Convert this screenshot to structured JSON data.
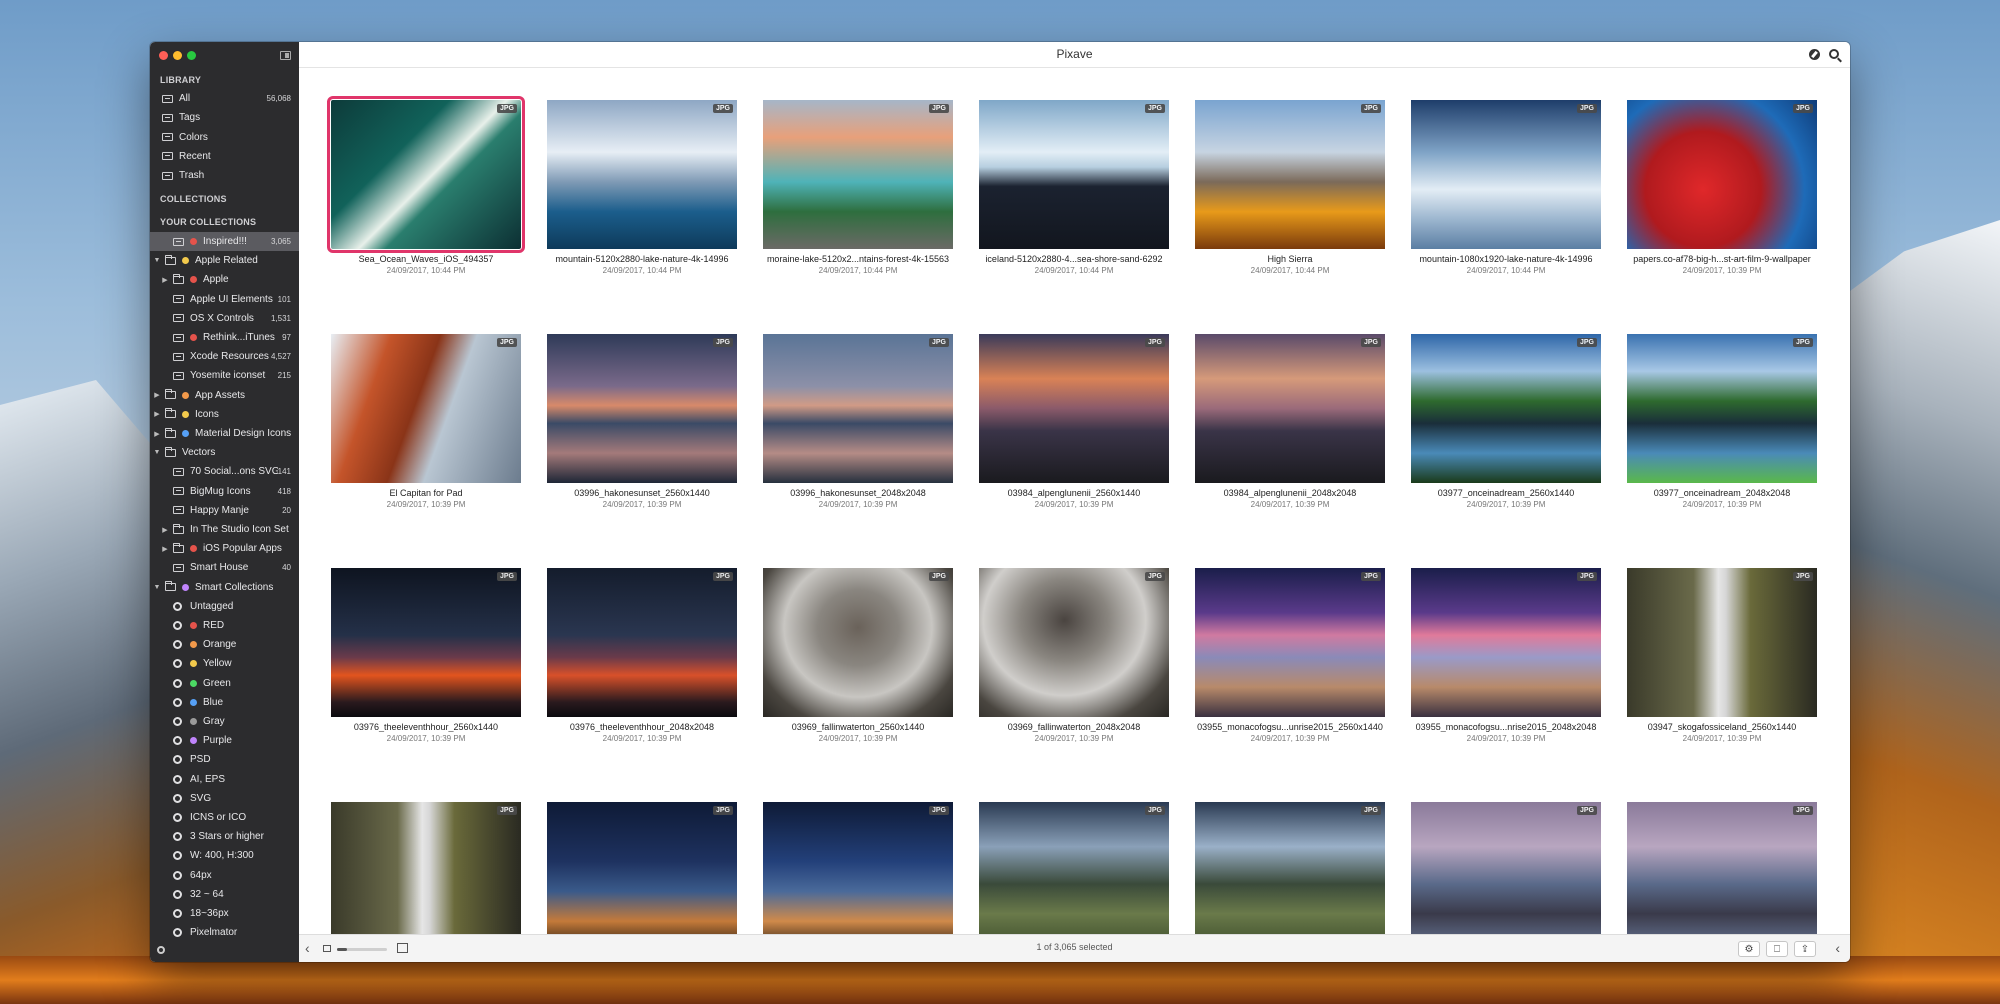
{
  "app": {
    "title": "Pixave"
  },
  "sidebar": {
    "library_header": "LIBRARY",
    "library": [
      {
        "label": "All",
        "count": "56,068",
        "icon": "stack-icon"
      },
      {
        "label": "Tags",
        "count": "",
        "icon": "tag-icon"
      },
      {
        "label": "Colors",
        "count": "",
        "icon": "drop-icon"
      },
      {
        "label": "Recent",
        "count": "",
        "icon": "clock-icon"
      },
      {
        "label": "Trash",
        "count": "",
        "icon": "trash-icon"
      }
    ],
    "collections_header": "COLLECTIONS",
    "your_collections_header": "YOUR COLLECTIONS",
    "tree": [
      {
        "label": "Inspired!!!",
        "count": "3,065",
        "depth": 1,
        "icon": "coll",
        "dot": "#e5534b",
        "tri": "",
        "selected": true
      },
      {
        "label": "Apple Related",
        "count": "",
        "depth": 0,
        "icon": "folder",
        "dot": "#f2c94c",
        "tri": "▼"
      },
      {
        "label": "Apple",
        "count": "",
        "depth": 1,
        "icon": "folder",
        "dot": "#e5534b",
        "tri": "▶"
      },
      {
        "label": "Apple UI Elements",
        "count": "101",
        "depth": 1,
        "icon": "coll",
        "dot": "",
        "tri": ""
      },
      {
        "label": "OS X Controls",
        "count": "1,531",
        "depth": 1,
        "icon": "coll",
        "dot": "",
        "tri": ""
      },
      {
        "label": "Rethink...iTunes",
        "count": "97",
        "depth": 1,
        "icon": "coll",
        "dot": "#e5534b",
        "tri": ""
      },
      {
        "label": "Xcode Resources",
        "count": "4,527",
        "depth": 1,
        "icon": "coll",
        "dot": "",
        "tri": ""
      },
      {
        "label": "Yosemite iconset",
        "count": "215",
        "depth": 1,
        "icon": "coll",
        "dot": "",
        "tri": ""
      },
      {
        "label": "App Assets",
        "count": "",
        "depth": 0,
        "icon": "folder",
        "dot": "#f2994a",
        "tri": "▶"
      },
      {
        "label": "Icons",
        "count": "",
        "depth": 0,
        "icon": "folder",
        "dot": "#f2c94c",
        "tri": "▶"
      },
      {
        "label": "Material Design Icons",
        "count": "",
        "depth": 0,
        "icon": "folder",
        "dot": "#56a0f5",
        "tri": "▶"
      },
      {
        "label": "Vectors",
        "count": "",
        "depth": 0,
        "icon": "folder",
        "dot": "",
        "tri": "▼"
      },
      {
        "label": "70 Social...ons SVG",
        "count": "141",
        "depth": 1,
        "icon": "coll",
        "dot": "",
        "tri": ""
      },
      {
        "label": "BigMug Icons",
        "count": "418",
        "depth": 1,
        "icon": "coll",
        "dot": "",
        "tri": ""
      },
      {
        "label": "Happy Manje",
        "count": "20",
        "depth": 1,
        "icon": "coll",
        "dot": "",
        "tri": ""
      },
      {
        "label": "In The Studio Icon Set",
        "count": "",
        "depth": 1,
        "icon": "folder",
        "dot": "",
        "tri": "▶"
      },
      {
        "label": "iOS Popular Apps",
        "count": "",
        "depth": 1,
        "icon": "folder",
        "dot": "#e5534b",
        "tri": "▶"
      },
      {
        "label": "Smart House",
        "count": "40",
        "depth": 1,
        "icon": "coll",
        "dot": "",
        "tri": ""
      },
      {
        "label": "Smart Collections",
        "count": "",
        "depth": 0,
        "icon": "folder",
        "dot": "#c084fc",
        "tri": "▼"
      },
      {
        "label": "Untagged",
        "count": "",
        "depth": 1,
        "icon": "gear",
        "dot": "",
        "tri": ""
      },
      {
        "label": "RED",
        "count": "",
        "depth": 1,
        "icon": "gear",
        "dot": "#e5534b",
        "tri": ""
      },
      {
        "label": "Orange",
        "count": "",
        "depth": 1,
        "icon": "gear",
        "dot": "#f2994a",
        "tri": ""
      },
      {
        "label": "Yellow",
        "count": "",
        "depth": 1,
        "icon": "gear",
        "dot": "#f2c94c",
        "tri": ""
      },
      {
        "label": "Green",
        "count": "",
        "depth": 1,
        "icon": "gear",
        "dot": "#4cd964",
        "tri": ""
      },
      {
        "label": "Blue",
        "count": "",
        "depth": 1,
        "icon": "gear",
        "dot": "#56a0f5",
        "tri": ""
      },
      {
        "label": "Gray",
        "count": "",
        "depth": 1,
        "icon": "gear",
        "dot": "#9b9b9b",
        "tri": ""
      },
      {
        "label": "Purple",
        "count": "",
        "depth": 1,
        "icon": "gear",
        "dot": "#c084fc",
        "tri": ""
      },
      {
        "label": "PSD",
        "count": "",
        "depth": 1,
        "icon": "gear",
        "dot": "",
        "tri": ""
      },
      {
        "label": "AI, EPS",
        "count": "",
        "depth": 1,
        "icon": "gear",
        "dot": "",
        "tri": ""
      },
      {
        "label": "SVG",
        "count": "",
        "depth": 1,
        "icon": "gear",
        "dot": "",
        "tri": ""
      },
      {
        "label": "ICNS or ICO",
        "count": "",
        "depth": 1,
        "icon": "gear",
        "dot": "",
        "tri": ""
      },
      {
        "label": "3 Stars or higher",
        "count": "",
        "depth": 1,
        "icon": "gear",
        "dot": "",
        "tri": ""
      },
      {
        "label": "W: 400, H:300",
        "count": "",
        "depth": 1,
        "icon": "gear",
        "dot": "",
        "tri": ""
      },
      {
        "label": "64px",
        "count": "",
        "depth": 1,
        "icon": "gear",
        "dot": "",
        "tri": ""
      },
      {
        "label": "32 ~ 64",
        "count": "",
        "depth": 1,
        "icon": "gear",
        "dot": "",
        "tri": ""
      },
      {
        "label": "18~36px",
        "count": "",
        "depth": 1,
        "icon": "gear",
        "dot": "",
        "tri": ""
      },
      {
        "label": "Pixelmator",
        "count": "",
        "depth": 1,
        "icon": "gear",
        "dot": "",
        "tri": ""
      }
    ]
  },
  "grid": {
    "badge": "JPG",
    "items": [
      {
        "name": "Sea_Ocean_Waves_iOS_494357",
        "date": "24/09/2017, 10:44 PM",
        "selected": true,
        "bg": "linear-gradient(135deg,#0d3b3a 0%,#11625a 35%,#e8f0ea 52%,#2a7e6e 60%,#0c2f33 100%)"
      },
      {
        "name": "mountain-5120x2880-lake-nature-4k-14996",
        "date": "24/09/2017, 10:44 PM",
        "bg": "linear-gradient(180deg,#8ea7c4 0%,#e7eef5 35%,#7f9ab5 55%,#1b5e8c 75%,#0e3a5a 100%)"
      },
      {
        "name": "moraine-lake-5120x2...ntains-forest-4k-15563",
        "date": "24/09/2017, 10:44 PM",
        "bg": "linear-gradient(180deg,#a6b6c8 0%,#e8a07a 25%,#4fb3b8 55%,#2e6e3e 75%,#6b6a66 100%)"
      },
      {
        "name": "iceland-5120x2880-4...sea-shore-sand-6292",
        "date": "24/09/2017, 10:44 PM",
        "bg": "linear-gradient(180deg,#7fa7c8 0%,#e3eef6 35%,#b7cfe0 45%,#1b2230 58%,#12161e 100%)"
      },
      {
        "name": "High Sierra",
        "date": "24/09/2017, 10:44 PM",
        "bg": "linear-gradient(180deg,#7aa4d0 0%,#c7d4e2 35%,#7b6a5a 55%,#e89a1a 75%,#7a3a0c 100%)"
      },
      {
        "name": "mountain-1080x1920-lake-nature-4k-14996",
        "date": "24/09/2017, 10:44 PM",
        "bg": "linear-gradient(180deg,#1e3d6a 0%,#7fa3c6 35%,#e3edf5 60%,#9cb6cf 80%,#5b7ea3 100%)"
      },
      {
        "name": "papers.co-af78-big-h...st-art-film-9-wallpaper",
        "date": "24/09/2017, 10:39 PM",
        "bg": "radial-gradient(circle at 40% 60%,#e0282a 0%,#b01a1e 40%,#1e6bb8 70%,#0e3b78 100%)"
      },
      {
        "name": "El Capitan for Pad",
        "date": "24/09/2017, 10:39 PM",
        "bg": "linear-gradient(110deg,#e8eef4 0%,#c4542a 25%,#8a3418 45%,#b9c6d2 60%,#6c7c8e 100%)"
      },
      {
        "name": "03996_hakonesunset_2560x1440",
        "date": "24/09/2017, 10:39 PM",
        "bg": "linear-gradient(180deg,#2e3a58 0%,#7a6a8a 35%,#d88a6a 48%,#3a4a66 60%,#a47a7a 80%,#1e2636 100%)"
      },
      {
        "name": "03996_hakonesunset_2048x2048",
        "date": "24/09/2017, 10:39 PM",
        "bg": "linear-gradient(180deg,#5a7496 0%,#8c90a8 35%,#d19b86 48%,#3a4a66 60%,#b58c86 80%,#26303e 100%)"
      },
      {
        "name": "03984_alpenglunenii_2560x1440",
        "date": "24/09/2017, 10:39 PM",
        "bg": "linear-gradient(180deg,#3a3a5a 0%,#d98256 30%,#8a5a6a 50%,#3a3448 65%,#1a1a1e 100%)"
      },
      {
        "name": "03984_alpenglunenii_2048x2048",
        "date": "24/09/2017, 10:39 PM",
        "bg": "linear-gradient(180deg,#5a4a6a 0%,#d69a7a 30%,#9a6a7a 50%,#3a3448 65%,#1a1a1e 100%)"
      },
      {
        "name": "03977_onceinadream_2560x1440",
        "date": "24/09/2017, 10:39 PM",
        "bg": "linear-gradient(180deg,#2e66a8 0%,#9cc0e0 25%,#2e6a2e 45%,#1a2e3a 60%,#4a8ab8 80%,#1a3a1a 100%)"
      },
      {
        "name": "03977_onceinadream_2048x2048",
        "date": "24/09/2017, 10:39 PM",
        "bg": "linear-gradient(180deg,#3a72b0 0%,#a8c8e6 25%,#2e6a2e 45%,#1a2e3a 60%,#4a8ab8 80%,#5ab84a 100%)"
      },
      {
        "name": "03976_theeleventhhour_2560x1440",
        "date": "24/09/2017, 10:39 PM",
        "bg": "linear-gradient(180deg,#0e1420 0%,#243048 45%,#6a3a4a 60%,#e2541e 72%,#2a1a1e 90%,#0a0a0e 100%)"
      },
      {
        "name": "03976_theeleventhhour_2048x2048",
        "date": "24/09/2017, 10:39 PM",
        "bg": "linear-gradient(180deg,#141c2c 0%,#2a3650 45%,#6a3a4a 60%,#d8502a 72%,#2a1a1e 90%,#0a0a0e 100%)"
      },
      {
        "name": "03969_fallinwaterton_2560x1440",
        "date": "24/09/2017, 10:39 PM",
        "bg": "radial-gradient(ellipse at 50% 40%,#6a625a 0%,#8a8680 30%,#c8c6c2 55%,#4a4640 80%,#2a2824 100%)"
      },
      {
        "name": "03969_fallinwaterton_2048x2048",
        "date": "24/09/2017, 10:39 PM",
        "bg": "radial-gradient(ellipse at 45% 35%,#4a4440 0%,#8a8680 30%,#d0cecb 55%,#4a4640 80%,#2a2824 100%)"
      },
      {
        "name": "03955_monacofogsu...unrise2015_2560x1440",
        "date": "24/09/2017, 10:39 PM",
        "bg": "linear-gradient(180deg,#1a1e4a 0%,#5a3a8a 30%,#d07aa0 45%,#8a8ab8 60%,#b88a6a 80%,#3a3040 100%)"
      },
      {
        "name": "03955_monacofogsu...nrise2015_2048x2048",
        "date": "24/09/2017, 10:39 PM",
        "bg": "linear-gradient(180deg,#1a1e4a 0%,#5a3a8a 30%,#e07a9a 45%,#9a9ac8 60%,#b88a6a 80%,#3a3040 100%)"
      },
      {
        "name": "03947_skogafossiceland_2560x1440",
        "date": "24/09/2017, 10:39 PM",
        "bg": "linear-gradient(90deg,#3a3a2a 0%,#6a6a4a 35%,#e6e6e6 48%,#d6d6d6 52%,#6a6a3a 65%,#2a2a22 100%)"
      },
      {
        "name": "",
        "date": "",
        "bg": "linear-gradient(90deg,#3a3a2a 0%,#6a6a4a 35%,#e6e6e6 48%,#d6d6d6 52%,#6a6a3a 65%,#2a2a22 100%)"
      },
      {
        "name": "",
        "date": "",
        "bg": "linear-gradient(180deg,#0e1a36 0%,#1e3260 40%,#3a5a8a 60%,#c47a3a 80%,#1a140e 100%)"
      },
      {
        "name": "",
        "date": "",
        "bg": "linear-gradient(180deg,#0e1a36 0%,#23407a 40%,#4a6a9a 60%,#d08a4a 80%,#1a140e 100%)"
      },
      {
        "name": "",
        "date": "",
        "bg": "linear-gradient(180deg,#2a3a52 0%,#8aa0b8 30%,#3a4a3a 55%,#6a7a4a 75%,#3a4a2a 100%)"
      },
      {
        "name": "",
        "date": "",
        "bg": "linear-gradient(180deg,#2a3a52 0%,#9ab0c8 30%,#3a4a3a 55%,#6a7a4a 75%,#3a4a2a 100%)"
      },
      {
        "name": "",
        "date": "",
        "bg": "linear-gradient(180deg,#8a7a9a 0%,#b8a6c0 30%,#5a6a8a 55%,#3a3a4a 75%,#6a7a9a 100%)"
      },
      {
        "name": "",
        "date": "",
        "bg": "linear-gradient(180deg,#8a7a9a 0%,#b8a6c0 30%,#5a6a8a 55%,#3a3a4a 75%,#6a7a9a 100%)"
      }
    ]
  },
  "bottombar": {
    "back": "‹",
    "status": "1 of 3,065 selected",
    "settings_glyph": "⚙",
    "info_glyph": "⎕",
    "share_glyph": "⇪",
    "collapse": "‹"
  }
}
